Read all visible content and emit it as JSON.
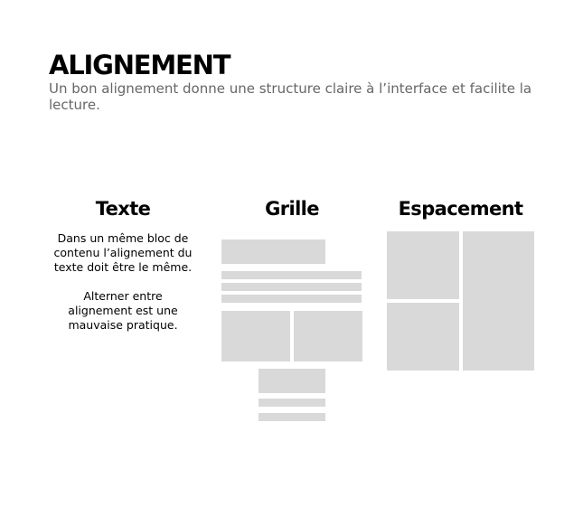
{
  "header": {
    "title": "ALIGNEMENT",
    "subtitle": "Un bon alignement donne une structure claire à l’interface et facilite la lecture."
  },
  "columns": {
    "texte": {
      "title": "Texte",
      "paragraph_1": "Dans un même bloc de contenu l’alignement du texte doit être le même.",
      "paragraph_2": "Alterner entre alignement est une mauvaise pratique."
    },
    "grille": {
      "title": "Grille"
    },
    "espacement": {
      "title": "Espacement"
    }
  },
  "colors": {
    "placeholder_block": "#d9d9d9",
    "title_text": "#000000",
    "subtitle_text": "#666666",
    "background": "#ffffff"
  }
}
